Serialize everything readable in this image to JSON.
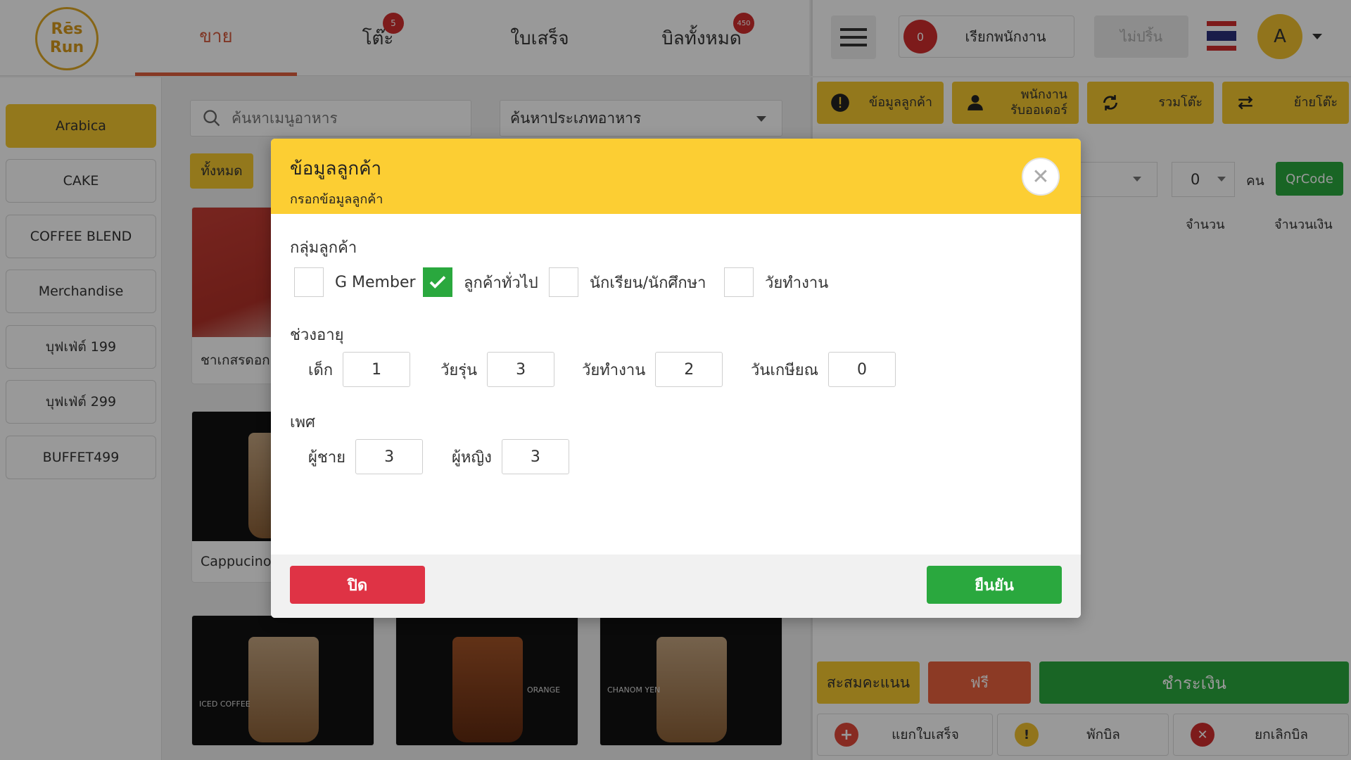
{
  "logo": {
    "line1": "Rēs",
    "line2": "Run"
  },
  "nav": {
    "tabs": [
      {
        "label": "ขาย",
        "badge": ""
      },
      {
        "label": "โต๊ะ",
        "badge": "5"
      },
      {
        "label": "ใบเสร็จ",
        "badge": ""
      },
      {
        "label": "บิลทั้งหมด",
        "badge": "450"
      }
    ]
  },
  "topbar": {
    "call_count": "0",
    "call_label": "เรียกพนักงาน",
    "print_label": "ไม่ปริ้น",
    "avatar_initial": "A",
    "flag_colors": [
      "#d02e2e",
      "#ffffff",
      "#2b2f7a",
      "#ffffff",
      "#d02e2e"
    ]
  },
  "sidebar": {
    "categories": [
      {
        "label": "Arabica"
      },
      {
        "label": "CAKE"
      },
      {
        "label": "COFFEE BLEND"
      },
      {
        "label": "Merchandise"
      },
      {
        "label": "บุฟเฟ่ต์ 199"
      },
      {
        "label": "บุฟเฟ่ต์ 299"
      },
      {
        "label": "BUFFET499"
      }
    ]
  },
  "main": {
    "search_placeholder": "ค้นหาเมนูอาหาร",
    "type_select": "ค้นหาประเภทอาหาร",
    "all_label": "ทั้งหมด",
    "cards": [
      {
        "name": "ชาเกสรดอก"
      },
      {
        "name": "Cappucino"
      },
      {
        "name": ""
      },
      {
        "name": ""
      },
      {
        "name": ""
      }
    ],
    "card_labels": {
      "iced_coffee": "ICED COFFEE",
      "orange": "ORANGE",
      "chanom_yen": "CHANOM YEN"
    }
  },
  "rpanel": {
    "actions": [
      {
        "label": "ข้อมูลลูกค้า"
      },
      {
        "label1": "พนักงาน",
        "label2": "รับออเดอร์"
      },
      {
        "label": "รวมโต๊ะ"
      },
      {
        "label": "ย้ายโต๊ะ"
      }
    ],
    "guest_count": "0",
    "person_label": "คน",
    "qr_label": "QrCode",
    "col_qty": "จำนวน",
    "col_amount": "จำนวนเงิน",
    "points_label": "สะสมคะแนน",
    "free_label": "ฟรี",
    "pay_label": "ชำระเงิน",
    "split_label": "แยกใบเสร็จ",
    "hold_label": "พักบิล",
    "cancel_label": "ยกเลิกบิล"
  },
  "modal": {
    "title": "ข้อมูลลูกค้า",
    "subtitle": "กรอกข้อมูลลูกค้า",
    "group_label": "กลุ่มลูกค้า",
    "groups": [
      {
        "label": "G Member",
        "checked": false
      },
      {
        "label": "ลูกค้าทั่วไป",
        "checked": true
      },
      {
        "label": "นักเรียน/นักศึกษา",
        "checked": false
      },
      {
        "label": "วัยทำงาน",
        "checked": false
      }
    ],
    "age_label": "ช่วงอายุ",
    "ages": [
      {
        "label": "เด็ก",
        "value": "1"
      },
      {
        "label": "วัยรุ่น",
        "value": "3"
      },
      {
        "label": "วัยทำงาน",
        "value": "2"
      },
      {
        "label": "วันเกษียณ",
        "value": "0"
      }
    ],
    "gender_label": "เพศ",
    "genders": [
      {
        "label": "ผู้ชาย",
        "value": "3"
      },
      {
        "label": "ผู้หญิง",
        "value": "3"
      }
    ],
    "close_label": "ปิด",
    "confirm_label": "ยืนยัน"
  }
}
